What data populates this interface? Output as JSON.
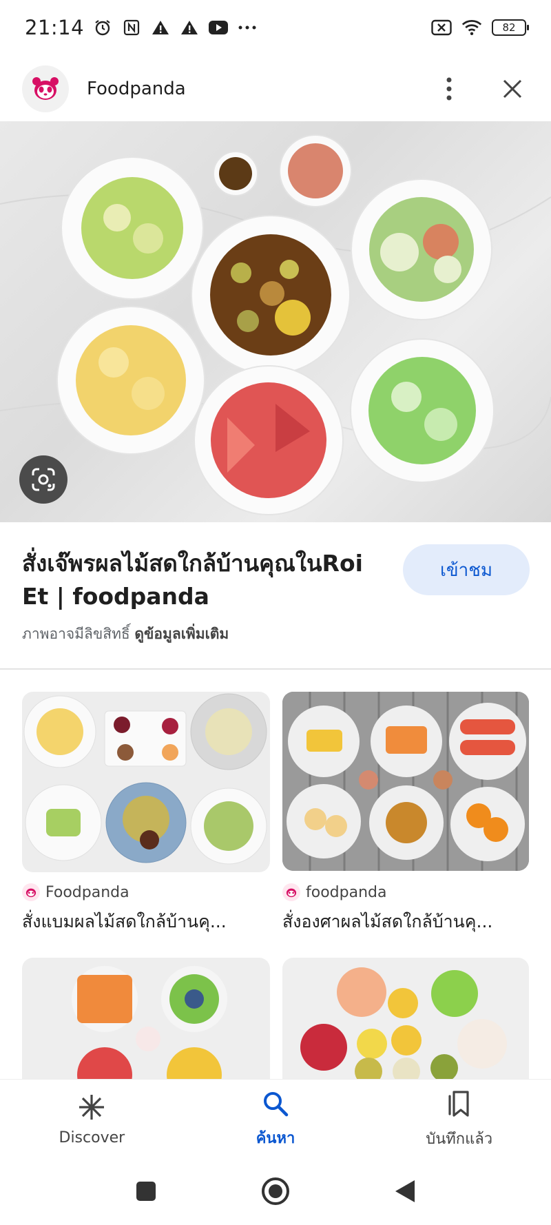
{
  "status_bar": {
    "time": "21:14",
    "battery": "82",
    "icons": [
      "alarm-icon",
      "nfc-icon",
      "warning-icon",
      "warning-icon",
      "youtube-icon",
      "more-dots-icon",
      "sim-off-icon",
      "wifi-icon",
      "battery-icon"
    ]
  },
  "header": {
    "site_name": "Foodpanda",
    "logo_icon": "foodpanda-logo-icon",
    "more_icon": "more-vert-icon",
    "close_icon": "close-icon"
  },
  "hero": {
    "lens_icon": "google-lens-icon"
  },
  "result": {
    "title": "สั่งเจ๊พรผลไม้สดใกล้บ้านคุณในRoi Et | foodpanda",
    "visit_label": "เข้าชม",
    "copyright_text": "ภาพอาจมีลิขสิทธิ์",
    "more_info_label": "ดูข้อมูลเพิ่มเติม"
  },
  "related": [
    {
      "source": "Foodpanda",
      "title": "สั่งแบมผลไม้สดใกล้บ้านคุ..."
    },
    {
      "source": "foodpanda",
      "title": "สั่งองศาผลไม้สดใกล้บ้านคุ..."
    },
    {
      "source": "",
      "title": ""
    },
    {
      "source": "",
      "title": ""
    }
  ],
  "bottom_nav": {
    "items": [
      {
        "label": "Discover",
        "icon": "discover-asterisk-icon",
        "active": false
      },
      {
        "label": "ค้นหา",
        "icon": "search-icon",
        "active": true
      },
      {
        "label": "บันทึกแล้ว",
        "icon": "bookmark-icon",
        "active": false
      }
    ]
  },
  "colors": {
    "accent": "#0b57d0",
    "visit_bg": "#e3ecfb",
    "brand_pink": "#d70f64"
  }
}
